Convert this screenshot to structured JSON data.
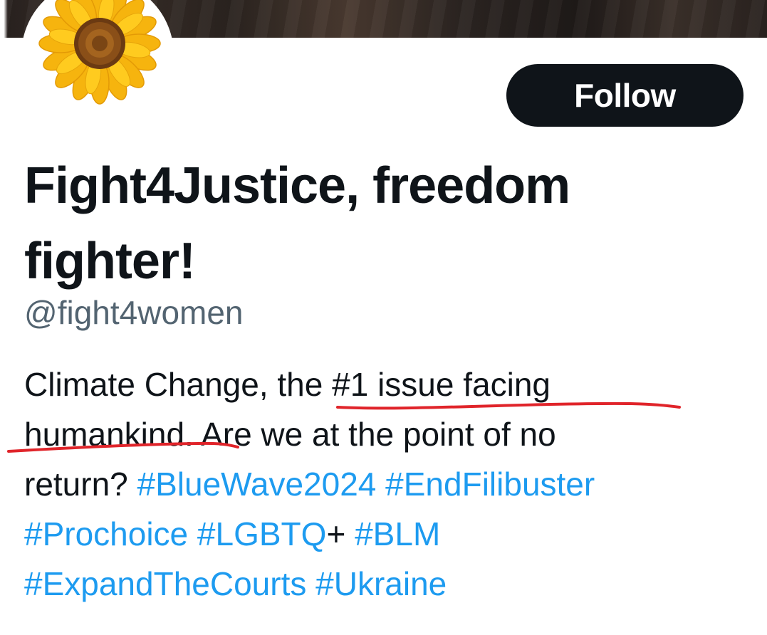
{
  "header": {
    "banner_icon": "banner-image",
    "avatar_icon": "sunflower-avatar"
  },
  "actions": {
    "follow_label": "Follow"
  },
  "profile": {
    "display_name": "Fight4Justice, freedom fighter!",
    "handle": "@fight4women"
  },
  "bio": {
    "line1_plain": "Climate Change, ",
    "line1_marked": "the #1 issue facing",
    "line2_marked": "humankind.",
    "line2_plain": " Are we at the point of no",
    "line3_plain": "return?  ",
    "line3_tag1": "#BlueWave2024",
    "line3_tag2": "#EndFilibuster",
    "line4_tag1": "#Prochoice",
    "line4_tag2": "#LGBTQ",
    "line4_plus": "+ ",
    "line4_tag3": "#BLM",
    "line5_tag1": "#ExpandTheCourts",
    "line5_tag2": "#Ukraine"
  },
  "colors": {
    "hashtag": "#1d9bf0",
    "text": "#0f1419",
    "handle": "#536471",
    "follow_bg": "#0f1419",
    "annotation": "#e0242a"
  }
}
